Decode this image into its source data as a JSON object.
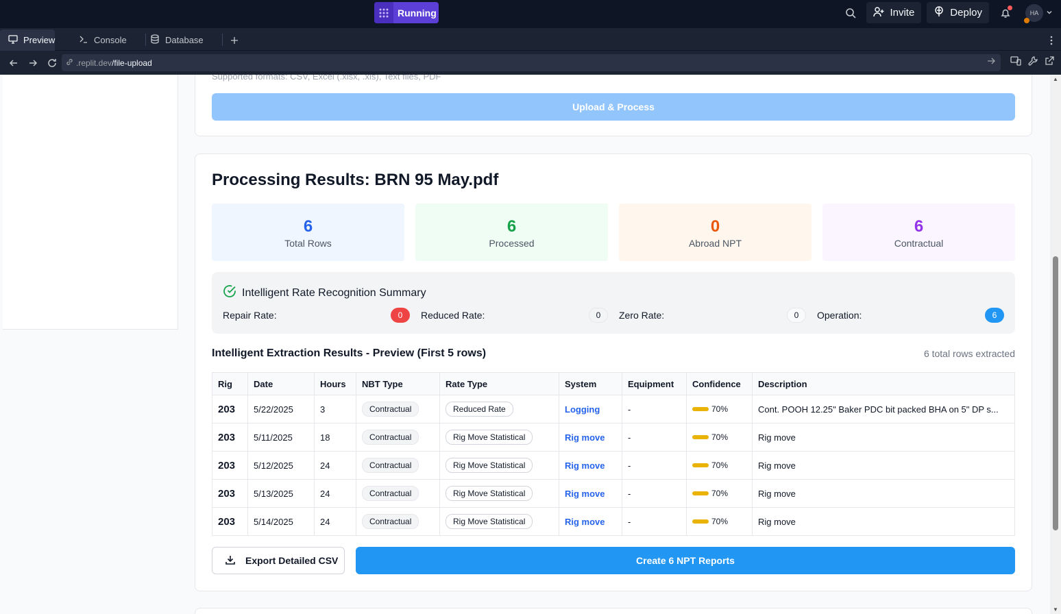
{
  "topbar": {
    "run_label": "Running",
    "invite_label": "Invite",
    "deploy_label": "Deploy",
    "avatar_initials": "HA"
  },
  "tabs": {
    "preview": "Preview",
    "console": "Console",
    "database": "Database"
  },
  "url": {
    "host": ".replit.dev",
    "path": "/file-upload"
  },
  "upload": {
    "supported_text": "Supported formats: CSV, Excel (.xlsx, .xls), Text files, PDF",
    "button_label": "Upload & Process"
  },
  "results": {
    "title": "Processing Results: BRN 95 May.pdf",
    "stats": [
      {
        "value": "6",
        "label": "Total Rows",
        "color": "#2563eb",
        "bg": "#eff6ff"
      },
      {
        "value": "6",
        "label": "Processed",
        "color": "#16a34a",
        "bg": "#f0fdf4"
      },
      {
        "value": "0",
        "label": "Abroad NPT",
        "color": "#ea580c",
        "bg": "#fff7ed"
      },
      {
        "value": "6",
        "label": "Contractual",
        "color": "#9333ea",
        "bg": "#faf5ff"
      }
    ],
    "summary": {
      "title": "Intelligent Rate Recognition Summary",
      "rates": [
        {
          "label": "Repair Rate:",
          "value": "0",
          "bg": "#ef4444",
          "fg": "#ffffff"
        },
        {
          "label": "Reduced Rate:",
          "value": "0",
          "bg": "#f3f4f6",
          "fg": "#111827"
        },
        {
          "label": "Zero Rate:",
          "value": "0",
          "bg": "#f9fafb",
          "fg": "#111827"
        },
        {
          "label": "Operation:",
          "value": "6",
          "bg": "#2196f3",
          "fg": "#ffffff"
        }
      ]
    },
    "extraction": {
      "title": "Intelligent Extraction Results - Preview (First 5 rows)",
      "count": "6 total rows extracted",
      "columns": [
        "Rig",
        "Date",
        "Hours",
        "NBT Type",
        "Rate Type",
        "System",
        "Equipment",
        "Confidence",
        "Description"
      ],
      "rows": [
        {
          "rig": "203",
          "date": "5/22/2025",
          "hours": "3",
          "nbt": "Contractual",
          "rate": "Reduced Rate",
          "system": "Logging",
          "equipment": "-",
          "confidence": "70%",
          "description": "Cont. POOH 12.25\" Baker PDC bit packed BHA on 5\" DP s..."
        },
        {
          "rig": "203",
          "date": "5/11/2025",
          "hours": "18",
          "nbt": "Contractual",
          "rate": "Rig Move Statistical",
          "system": "Rig move",
          "equipment": "-",
          "confidence": "70%",
          "description": "Rig move"
        },
        {
          "rig": "203",
          "date": "5/12/2025",
          "hours": "24",
          "nbt": "Contractual",
          "rate": "Rig Move Statistical",
          "system": "Rig move",
          "equipment": "-",
          "confidence": "70%",
          "description": "Rig move"
        },
        {
          "rig": "203",
          "date": "5/13/2025",
          "hours": "24",
          "nbt": "Contractual",
          "rate": "Rig Move Statistical",
          "system": "Rig move",
          "equipment": "-",
          "confidence": "70%",
          "description": "Rig move"
        },
        {
          "rig": "203",
          "date": "5/14/2025",
          "hours": "24",
          "nbt": "Contractual",
          "rate": "Rig Move Statistical",
          "system": "Rig move",
          "equipment": "-",
          "confidence": "70%",
          "description": "Rig move"
        }
      ]
    },
    "export_label": "Export Detailed CSV",
    "create_label": "Create 6 NPT Reports"
  }
}
